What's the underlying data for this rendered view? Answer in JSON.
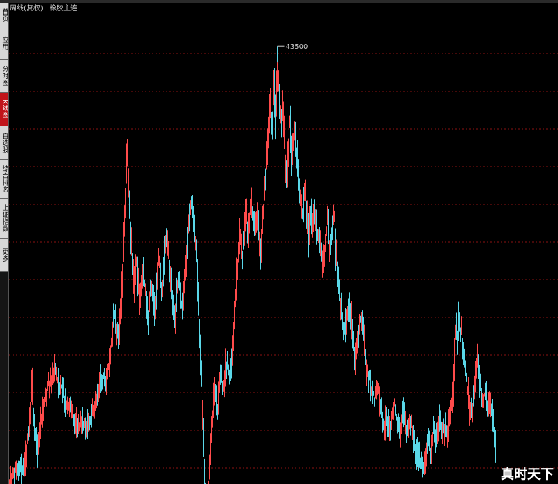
{
  "header": {
    "period": "周线(复权)",
    "symbol": "橡胶主连"
  },
  "sidebar": {
    "tabs": [
      {
        "key": "home",
        "label": "首页",
        "active": false
      },
      {
        "key": "apps",
        "label": "应用",
        "active": false
      },
      {
        "key": "intraday",
        "label": "分时图",
        "active": false
      },
      {
        "key": "kline",
        "label": "K线图",
        "active": true
      },
      {
        "key": "watchlist",
        "label": "自选股",
        "active": false
      },
      {
        "key": "ranking",
        "label": "综合排名",
        "active": false
      },
      {
        "key": "index",
        "label": "上证指数",
        "active": false
      },
      {
        "key": "more",
        "label": "更多",
        "active": false
      }
    ]
  },
  "colors": {
    "up": "#ff4b4b",
    "down": "#5ad7e8",
    "grid": "#8b1212",
    "background": "#000000",
    "label": "#cfcfcf"
  },
  "watermark": "真时天下",
  "chart_data": {
    "type": "candlestick",
    "peak_label": "43500",
    "ylim": [
      8000,
      46000
    ],
    "grid": "dashed-horizontal",
    "close_path": [
      [
        0,
        8200
      ],
      [
        10,
        9500
      ],
      [
        20,
        9000
      ],
      [
        28,
        13000
      ],
      [
        32,
        16300
      ],
      [
        36,
        12000
      ],
      [
        40,
        10500
      ],
      [
        46,
        13500
      ],
      [
        52,
        15500
      ],
      [
        58,
        16200
      ],
      [
        64,
        17500
      ],
      [
        70,
        16000
      ],
      [
        76,
        15800
      ],
      [
        80,
        14200
      ],
      [
        86,
        14600
      ],
      [
        92,
        13200
      ],
      [
        98,
        12800
      ],
      [
        104,
        13000
      ],
      [
        110,
        12600
      ],
      [
        116,
        13200
      ],
      [
        120,
        13800
      ],
      [
        126,
        15500
      ],
      [
        132,
        16800
      ],
      [
        138,
        16500
      ],
      [
        144,
        18500
      ],
      [
        150,
        22000
      ],
      [
        156,
        19500
      ],
      [
        160,
        22500
      ],
      [
        164,
        28500
      ],
      [
        168,
        35000
      ],
      [
        171,
        31500
      ],
      [
        174,
        27500
      ],
      [
        178,
        24000
      ],
      [
        182,
        26000
      ],
      [
        186,
        22500
      ],
      [
        190,
        25500
      ],
      [
        194,
        24000
      ],
      [
        198,
        21000
      ],
      [
        202,
        24500
      ],
      [
        208,
        21800
      ],
      [
        214,
        26500
      ],
      [
        218,
        23500
      ],
      [
        222,
        27000
      ],
      [
        226,
        28500
      ],
      [
        228,
        26500
      ],
      [
        232,
        24000
      ],
      [
        236,
        21000
      ],
      [
        242,
        24800
      ],
      [
        248,
        22000
      ],
      [
        254,
        27000
      ],
      [
        260,
        31000
      ],
      [
        264,
        29000
      ],
      [
        268,
        27000
      ],
      [
        272,
        21000
      ],
      [
        276,
        14500
      ],
      [
        280,
        8000
      ],
      [
        284,
        6500
      ],
      [
        286,
        9000
      ],
      [
        290,
        12800
      ],
      [
        294,
        16000
      ],
      [
        298,
        14000
      ],
      [
        302,
        17000
      ],
      [
        306,
        15500
      ],
      [
        310,
        18000
      ],
      [
        316,
        17000
      ],
      [
        320,
        19000
      ],
      [
        324,
        23500
      ],
      [
        330,
        28500
      ],
      [
        334,
        26500
      ],
      [
        338,
        30500
      ],
      [
        342,
        28000
      ],
      [
        346,
        31000
      ],
      [
        352,
        28500
      ],
      [
        356,
        29800
      ],
      [
        360,
        26500
      ],
      [
        364,
        30500
      ],
      [
        368,
        34000
      ],
      [
        372,
        37500
      ],
      [
        374,
        39500
      ],
      [
        376,
        36500
      ],
      [
        379,
        40500
      ],
      [
        381,
        37000
      ],
      [
        384,
        42200
      ],
      [
        387,
        38800
      ],
      [
        390,
        36500
      ],
      [
        392,
        39000
      ],
      [
        394,
        35500
      ],
      [
        397,
        32000
      ],
      [
        400,
        36000
      ],
      [
        402,
        37500
      ],
      [
        404,
        34000
      ],
      [
        408,
        36800
      ],
      [
        412,
        34500
      ],
      [
        416,
        31500
      ],
      [
        420,
        29500
      ],
      [
        424,
        32500
      ],
      [
        428,
        27000
      ],
      [
        430,
        30500
      ],
      [
        434,
        29000
      ],
      [
        438,
        30500
      ],
      [
        440,
        28500
      ],
      [
        444,
        28000
      ],
      [
        448,
        25500
      ],
      [
        452,
        27000
      ],
      [
        456,
        29500
      ],
      [
        458,
        26500
      ],
      [
        462,
        28500
      ],
      [
        466,
        30000
      ],
      [
        468,
        26500
      ],
      [
        472,
        24000
      ],
      [
        476,
        22000
      ],
      [
        480,
        20500
      ],
      [
        484,
        21500
      ],
      [
        488,
        22500
      ],
      [
        492,
        19500
      ],
      [
        496,
        18000
      ],
      [
        500,
        20500
      ],
      [
        504,
        21500
      ],
      [
        508,
        20000
      ],
      [
        512,
        17000
      ],
      [
        516,
        16500
      ],
      [
        520,
        15500
      ],
      [
        524,
        14800
      ],
      [
        528,
        16000
      ],
      [
        532,
        14000
      ],
      [
        536,
        12500
      ],
      [
        540,
        13500
      ],
      [
        544,
        12000
      ],
      [
        548,
        13500
      ],
      [
        552,
        14500
      ],
      [
        556,
        13000
      ],
      [
        560,
        12000
      ],
      [
        564,
        13800
      ],
      [
        570,
        12200
      ],
      [
        576,
        13000
      ],
      [
        580,
        11000
      ],
      [
        584,
        10500
      ],
      [
        588,
        10000
      ],
      [
        592,
        9000
      ],
      [
        596,
        9800
      ],
      [
        600,
        11500
      ],
      [
        604,
        10500
      ],
      [
        608,
        12500
      ],
      [
        612,
        11200
      ],
      [
        616,
        13500
      ],
      [
        620,
        11800
      ],
      [
        624,
        12800
      ],
      [
        628,
        12000
      ],
      [
        632,
        14000
      ],
      [
        636,
        15500
      ],
      [
        638,
        19000
      ],
      [
        640,
        20500
      ],
      [
        642,
        19500
      ],
      [
        644,
        21800
      ],
      [
        646,
        20000
      ],
      [
        648,
        20800
      ],
      [
        650,
        19200
      ],
      [
        652,
        18000
      ],
      [
        654,
        16800
      ],
      [
        656,
        15800
      ],
      [
        658,
        15000
      ],
      [
        660,
        13800
      ],
      [
        664,
        14200
      ],
      [
        668,
        17000
      ],
      [
        671,
        18500
      ],
      [
        674,
        16000
      ],
      [
        678,
        14800
      ],
      [
        682,
        15500
      ],
      [
        686,
        14000
      ],
      [
        690,
        14500
      ],
      [
        694,
        12500
      ],
      [
        697,
        11000
      ]
    ]
  }
}
